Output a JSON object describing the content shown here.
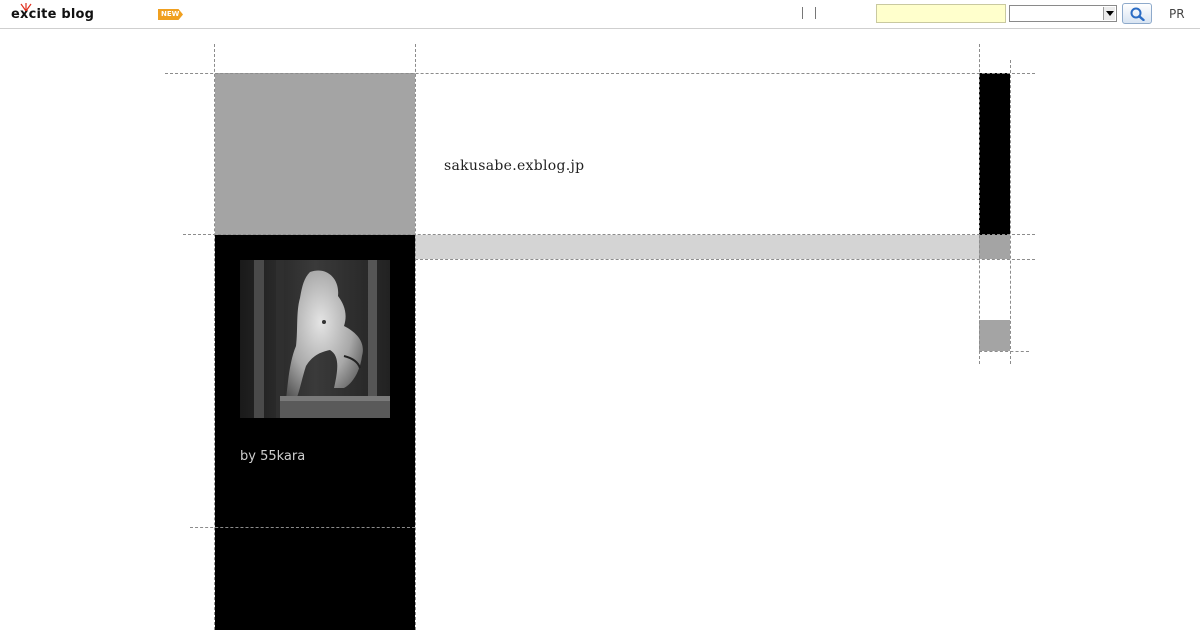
{
  "toolbar": {
    "logo_text": "excite blog",
    "new_badge": "NEW",
    "search": {
      "value": "",
      "placeholder": ""
    },
    "search_scope": {
      "selected": ""
    },
    "search_button_icon": "magnifier-icon",
    "pr_link": "PR"
  },
  "blog": {
    "url": "sakusabe.exblog.jp",
    "author": "by 55kara",
    "profile_image": "grayscale photo of a carved wooden torso statue"
  },
  "colors": {
    "header_gray": "#a4a4a4",
    "sidebar_black": "#000000",
    "band_gray": "#d4d4d4",
    "search_field_bg": "#ffffcc",
    "new_badge": "#f0a020"
  }
}
